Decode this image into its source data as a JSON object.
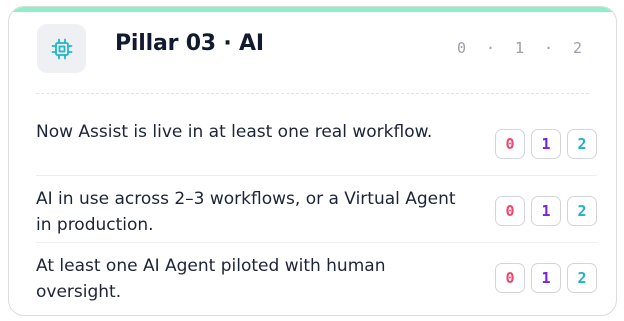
{
  "card": {
    "title": "Pillar 03 · AI",
    "icon": "chip-icon",
    "accent_color": "#8ef0c9",
    "icon_color": "#20b7c9",
    "legend": [
      "0",
      "·",
      "1",
      "·",
      "2"
    ]
  },
  "criteria": [
    {
      "text": "Now Assist is live in at least one real workflow.",
      "scores": [
        "0",
        "1",
        "2"
      ]
    },
    {
      "text": "AI in use across 2–3 workflows, or a Virtual Agent in production.",
      "scores": [
        "0",
        "1",
        "2"
      ]
    },
    {
      "text": "At least one AI Agent piloted with human oversight.",
      "scores": [
        "0",
        "1",
        "2"
      ]
    }
  ],
  "score_colors": {
    "0": "#f2456b",
    "1": "#7a22e0",
    "2": "#1fb2c6"
  }
}
